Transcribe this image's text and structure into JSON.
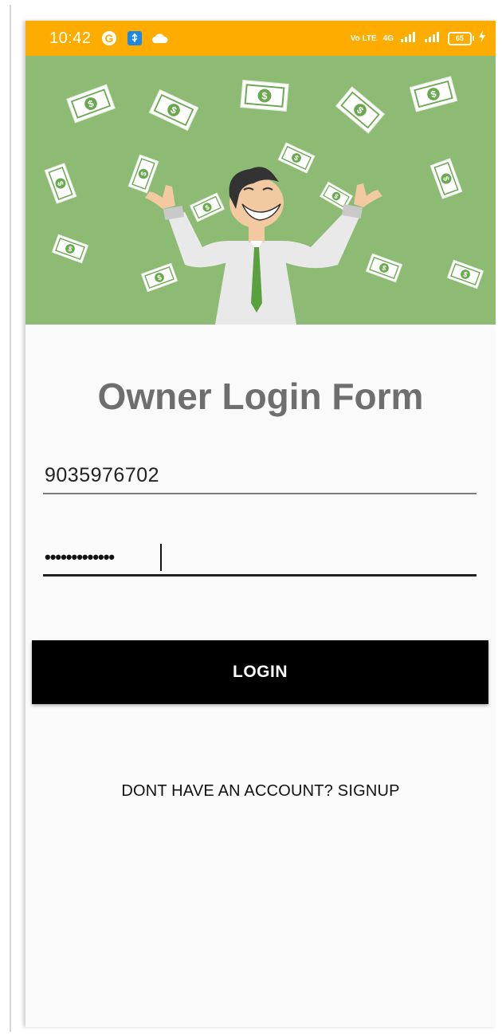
{
  "status_bar": {
    "time": "10:42",
    "net_volte": "Vo LTE",
    "net_4g": "4G",
    "battery": "65",
    "color": "#ffac00"
  },
  "hero": {
    "background": "#8dbb73",
    "illustration": "man-throwing-money"
  },
  "form": {
    "title": "Owner Login Form",
    "phone_value": "9035976702",
    "password_mask": "•••••••••••••",
    "login_label": "LOGIN",
    "signup_label": "DONT HAVE AN ACCOUNT? SIGNUP"
  }
}
